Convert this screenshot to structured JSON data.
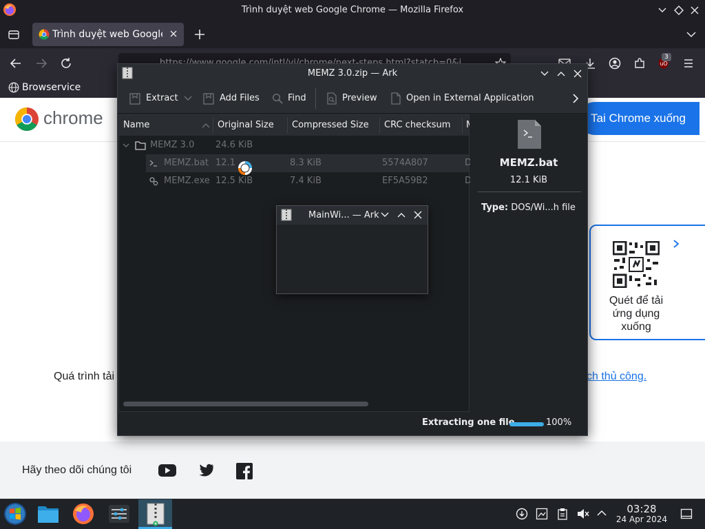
{
  "firefox": {
    "window_title": "Trình duyệt web Google Chrome — Mozilla Firefox",
    "tab_title": "Trình duyệt web Google C",
    "url": "https://www.google.com/intl/vi/chrome/next-steps.html?statcb=0&i",
    "bookmark": "Browservice",
    "extensions_badge": "3"
  },
  "webpage": {
    "brand": "chrome",
    "download_button": "Tai Chrome xuống",
    "qr_caption": "Quét để tải ứng dụng xuống",
    "progress_text_left": "Quá trình tải",
    "progress_text_right": "ch thủ công.",
    "follow_label": "Hãy theo dõi chúng tôi"
  },
  "ark": {
    "title": "MEMZ 3.0.zip — Ark",
    "toolbar": {
      "extract": "Extract",
      "add_files": "Add Files",
      "find": "Find",
      "preview": "Preview",
      "open_external": "Open in External Application"
    },
    "columns": [
      "Name",
      "Original Size",
      "Compressed Size",
      "CRC checksum",
      "M"
    ],
    "rows": [
      {
        "name": "MEMZ 3.0",
        "original": "24.6 KiB",
        "compressed": "",
        "crc": "",
        "m": ""
      },
      {
        "name": "MEMZ.bat",
        "original": "12.1 KiB",
        "compressed": "8.3 KiB",
        "crc": "5574A807",
        "m": "D"
      },
      {
        "name": "MEMZ.exe",
        "original": "12.5 KiB",
        "compressed": "7.4 KiB",
        "crc": "EF5A59B2",
        "m": "D"
      }
    ],
    "panel": {
      "filename": "MEMZ.bat",
      "size": "12.1 KiB",
      "type_label": "Type:",
      "type_value": "DOS/Wi...h file"
    },
    "status": {
      "text": "Extracting one file",
      "progress": 100,
      "percent_label": "100%"
    }
  },
  "mainwindow": {
    "title": "MainWi... — Ark"
  },
  "taskbar": {
    "time": "03:28",
    "date": "24 Apr 2024"
  },
  "colors": {
    "accent_blue": "#1a73e8",
    "kde_accent": "#3daee9",
    "ark_bg": "#202326"
  }
}
